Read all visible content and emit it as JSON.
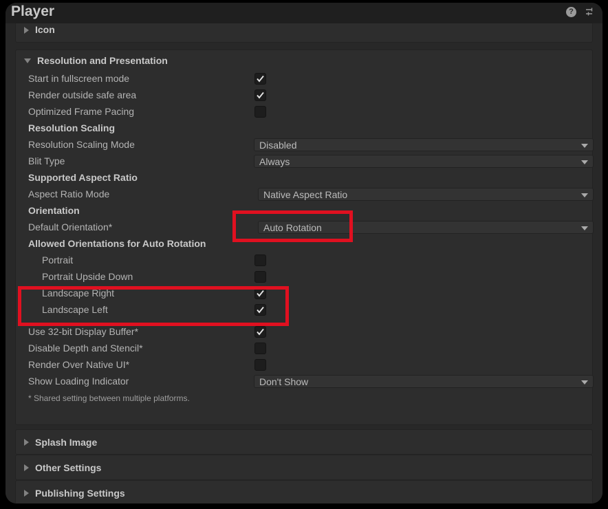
{
  "window": {
    "title": "Player",
    "help_icon": "help-question-icon",
    "preset_icon": "preset-settings-icon"
  },
  "sections": {
    "icon": {
      "label": "Icon",
      "expanded": false,
      "arrow_icon": "triangle-right-icon"
    },
    "resolution": {
      "label": "Resolution and Presentation",
      "expanded": true,
      "arrow_icon": "triangle-down-icon"
    },
    "splash": {
      "label": "Splash Image",
      "expanded": false,
      "arrow_icon": "triangle-right-icon"
    },
    "other": {
      "label": "Other Settings",
      "expanded": false,
      "arrow_icon": "triangle-right-icon"
    },
    "publishing": {
      "label": "Publishing Settings",
      "expanded": false,
      "arrow_icon": "triangle-right-icon"
    }
  },
  "rows": {
    "start_fullscreen": {
      "label": "Start in fullscreen mode",
      "checked": true
    },
    "render_outside_safe": {
      "label": "Render outside safe area",
      "checked": true
    },
    "optimized_frame_pacing": {
      "label": "Optimized Frame Pacing",
      "checked": false
    },
    "resolution_scaling_header": {
      "label": "Resolution Scaling"
    },
    "resolution_scaling_mode": {
      "label": "Resolution Scaling Mode",
      "value": "Disabled"
    },
    "blit_type": {
      "label": "Blit Type",
      "value": "Always"
    },
    "supported_aspect_header": {
      "label": "Supported Aspect Ratio"
    },
    "aspect_ratio_mode": {
      "label": "Aspect Ratio Mode",
      "value": "Native Aspect Ratio"
    },
    "orientation_header": {
      "label": "Orientation"
    },
    "default_orientation": {
      "label": "Default Orientation*",
      "value": "Auto Rotation"
    },
    "allowed_orientations_header": {
      "label": "Allowed Orientations for Auto Rotation"
    },
    "portrait": {
      "label": "Portrait",
      "checked": false
    },
    "portrait_upside_down": {
      "label": "Portrait Upside Down",
      "checked": false
    },
    "landscape_right": {
      "label": "Landscape Right",
      "checked": true
    },
    "landscape_left": {
      "label": "Landscape Left",
      "checked": true
    },
    "use_32bit_display_buffer": {
      "label": "Use 32-bit Display Buffer*",
      "checked": true
    },
    "disable_depth_stencil": {
      "label": "Disable Depth and Stencil*",
      "checked": false
    },
    "render_over_native_ui": {
      "label": "Render Over Native UI*",
      "checked": false
    },
    "show_loading_indicator": {
      "label": "Show Loading Indicator",
      "value": "Don't Show"
    }
  },
  "footnote": "* Shared setting between multiple platforms.",
  "annotations": {
    "highlight_color": "#e01020",
    "boxes": [
      {
        "name": "default-orientation-highlight"
      },
      {
        "name": "landscape-orientations-highlight"
      }
    ]
  }
}
